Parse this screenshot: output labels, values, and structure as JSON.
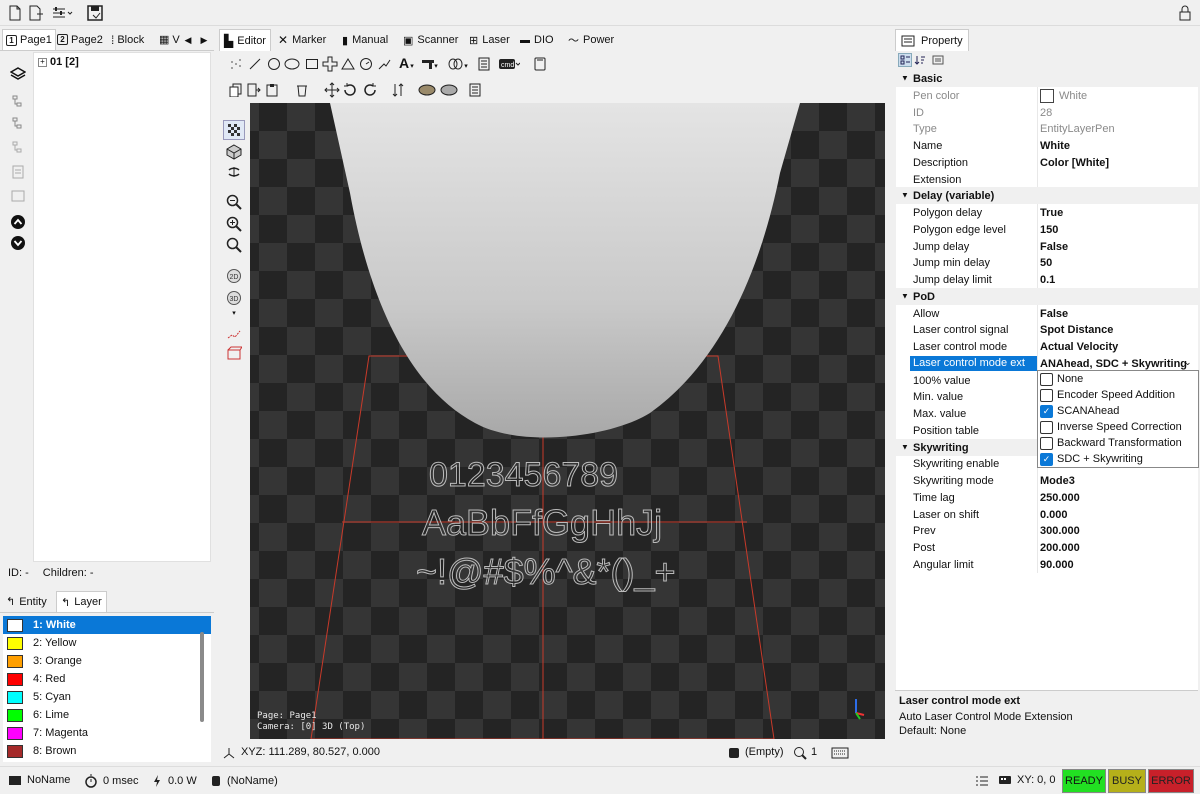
{
  "colors": {
    "accent": "#0a78d7",
    "ready": "#22e022",
    "busy": "#b5b01a",
    "error": "#c8202a",
    "viewport_bg": "#2e2e2e"
  },
  "left_tabs": [
    {
      "num": "1",
      "label": "Page1"
    },
    {
      "num": "2",
      "label": "Page2"
    },
    {
      "label": "Block"
    },
    {
      "label": "V"
    }
  ],
  "tree": {
    "root_label": "01 [2]"
  },
  "tree_status": {
    "id_label": "ID: -",
    "children_label": "Children: -"
  },
  "layer_tabs": [
    {
      "label": "Entity"
    },
    {
      "label": "Layer"
    }
  ],
  "layers": [
    {
      "label": "1: White",
      "color": "#ffffff"
    },
    {
      "label": "2: Yellow",
      "color": "#ffff00"
    },
    {
      "label": "3: Orange",
      "color": "#ff9f00"
    },
    {
      "label": "4: Red",
      "color": "#ff0000"
    },
    {
      "label": "5: Cyan",
      "color": "#00ffff"
    },
    {
      "label": "6: Lime",
      "color": "#00ff00"
    },
    {
      "label": "7: Magenta",
      "color": "#ff00ff"
    },
    {
      "label": "8: Brown",
      "color": "#a52a2a"
    }
  ],
  "editor_tabs": [
    {
      "label": "Editor"
    },
    {
      "label": "Marker"
    },
    {
      "label": "Manual"
    },
    {
      "label": "Scanner"
    },
    {
      "label": "Laser"
    },
    {
      "label": "DIO"
    },
    {
      "label": "Power"
    }
  ],
  "viewport": {
    "text_line1": "0123456789",
    "text_line2": "AaBbFfGgHhJj",
    "text_line3": "~!@#$%^&*()_+",
    "page_label": "Page: Page1",
    "camera_label": "Camera: [0] 3D (Top)"
  },
  "view_status": {
    "xyz": "XYZ: 111.289, 80.527, 0.000",
    "selection": "(Empty)",
    "count": "1"
  },
  "property": {
    "title": "Property",
    "rows": [
      {
        "type": "cat",
        "k": "Basic"
      },
      {
        "type": "dis",
        "k": "Pen color",
        "v": "White",
        "swatch": true
      },
      {
        "type": "dis",
        "k": "ID",
        "v": "28"
      },
      {
        "type": "dis",
        "k": "Type",
        "v": "EntityLayerPen"
      },
      {
        "type": "val",
        "k": "Name",
        "v": "White"
      },
      {
        "type": "val",
        "k": "Description",
        "v": "Color [White]"
      },
      {
        "type": "val",
        "k": "Extension",
        "v": ""
      },
      {
        "type": "cat",
        "k": "Delay (variable)"
      },
      {
        "type": "val",
        "k": "Polygon delay",
        "v": "True"
      },
      {
        "type": "val",
        "k": "Polygon edge level",
        "v": "150"
      },
      {
        "type": "val",
        "k": "Jump delay",
        "v": "False"
      },
      {
        "type": "val",
        "k": "Jump min delay",
        "v": "50"
      },
      {
        "type": "val",
        "k": "Jump delay limit",
        "v": "0.1"
      },
      {
        "type": "cat",
        "k": "PoD"
      },
      {
        "type": "val",
        "k": "Allow",
        "v": "False"
      },
      {
        "type": "val",
        "k": "Laser control signal",
        "v": "Spot Distance"
      },
      {
        "type": "val",
        "k": "Laser control mode",
        "v": "Actual Velocity"
      },
      {
        "type": "sel",
        "k": "Laser control mode ext",
        "v": "ANAhead, SDC + Skywriting"
      },
      {
        "type": "val",
        "k": "100% value",
        "v": ""
      },
      {
        "type": "val",
        "k": "Min. value",
        "v": ""
      },
      {
        "type": "val",
        "k": "Max. value",
        "v": ""
      },
      {
        "type": "val",
        "k": "Position table",
        "v": ""
      },
      {
        "type": "cat",
        "k": "Skywriting"
      },
      {
        "type": "val",
        "k": "Skywriting enable",
        "v": ""
      },
      {
        "type": "val",
        "k": "Skywriting mode",
        "v": "Mode3"
      },
      {
        "type": "val",
        "k": "Time lag",
        "v": "250.000"
      },
      {
        "type": "val",
        "k": "Laser on shift",
        "v": "0.000"
      },
      {
        "type": "val",
        "k": "Prev",
        "v": "300.000"
      },
      {
        "type": "val",
        "k": "Post",
        "v": "200.000"
      },
      {
        "type": "val",
        "k": "Angular limit",
        "v": "90.000"
      }
    ],
    "dropdown_options": [
      {
        "label": "None",
        "checked": false
      },
      {
        "label": "Encoder Speed Addition",
        "checked": false
      },
      {
        "label": "SCANAhead",
        "checked": true
      },
      {
        "label": "Inverse Speed Correction",
        "checked": false
      },
      {
        "label": "Backward Transformation",
        "checked": false
      },
      {
        "label": "SDC + Skywriting",
        "checked": true
      }
    ],
    "desc_title": "Laser control mode ext",
    "desc_line1": "Auto Laser Control Mode Extension",
    "desc_line2": "Default: None"
  },
  "statusbar": {
    "name": "NoName",
    "time": "0 msec",
    "power": "0.0 W",
    "doc": "(NoName)",
    "xy": "XY: 0, 0",
    "ready": "READY",
    "busy": "BUSY",
    "error": "ERROR"
  }
}
